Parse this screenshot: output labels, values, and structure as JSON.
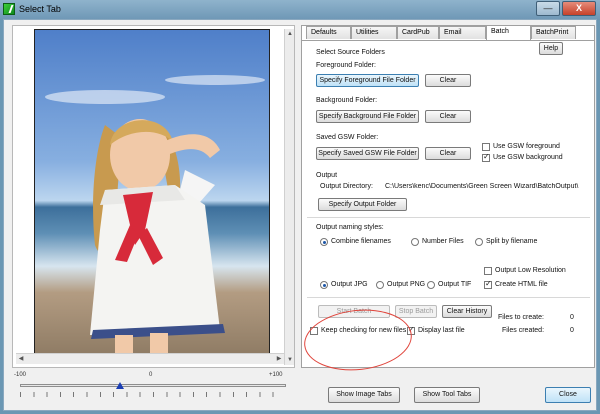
{
  "window": {
    "title": "Select Tab",
    "minimize_glyph": "—",
    "close_glyph": "X"
  },
  "slider": {
    "min_label": "-100",
    "mid_label": "0",
    "max_label": "+100",
    "value": -25
  },
  "tabs": [
    {
      "label": "Defaults",
      "active": false
    },
    {
      "label": "Utilities",
      "active": false
    },
    {
      "label": "CardPub",
      "active": false
    },
    {
      "label": "Email",
      "active": false
    },
    {
      "label": "Batch",
      "active": true
    },
    {
      "label": "BatchPrint",
      "active": false
    }
  ],
  "batch": {
    "help_label": "Help",
    "section_source": "Select Source Folders",
    "foreground_label": "Foreground Folder:",
    "foreground_button": "Specify Foreground File Folder",
    "background_label": "Background Folder:",
    "background_button": "Specify Background File Folder",
    "saved_gsw_label": "Saved GSW Folder:",
    "saved_gsw_button": "Specify Saved GSW File Folder",
    "clear_label": "Clear",
    "use_gsw_foreground": "Use GSW foreground",
    "use_gsw_background": "Use GSW background",
    "output_header": "Output",
    "output_directory_label": "Output Directory:",
    "output_directory_value": "C:\\Users\\kenc\\Documents\\Green Screen Wizard\\BatchOutput\\",
    "specify_output_button": "Specify Output Folder",
    "naming_label": "Output naming styles:",
    "naming_options": [
      "Combine filenames",
      "Number Files",
      "Split by filename"
    ],
    "format_options": [
      "Output JPG",
      "Output PNG",
      "Output TIF"
    ],
    "output_low_res": "Output Low Resolution",
    "create_html": "Create HTML file",
    "start_batch": "Start Batch",
    "stop_batch": "Stop Batch",
    "clear_history": "Clear History",
    "keep_checking": "Keep checking for new files",
    "display_last": "Display last file",
    "files_to_create_label": "Files to create:",
    "files_to_create_value": "0",
    "files_created_label": "Files created:",
    "files_created_value": "0"
  },
  "footer": {
    "show_image_tabs": "Show Image Tabs",
    "show_tool_tabs": "Show Tool Tabs",
    "close": "Close"
  },
  "colors": {
    "accent": "#3c7fb1",
    "annotation_circle": "#e0453c"
  }
}
